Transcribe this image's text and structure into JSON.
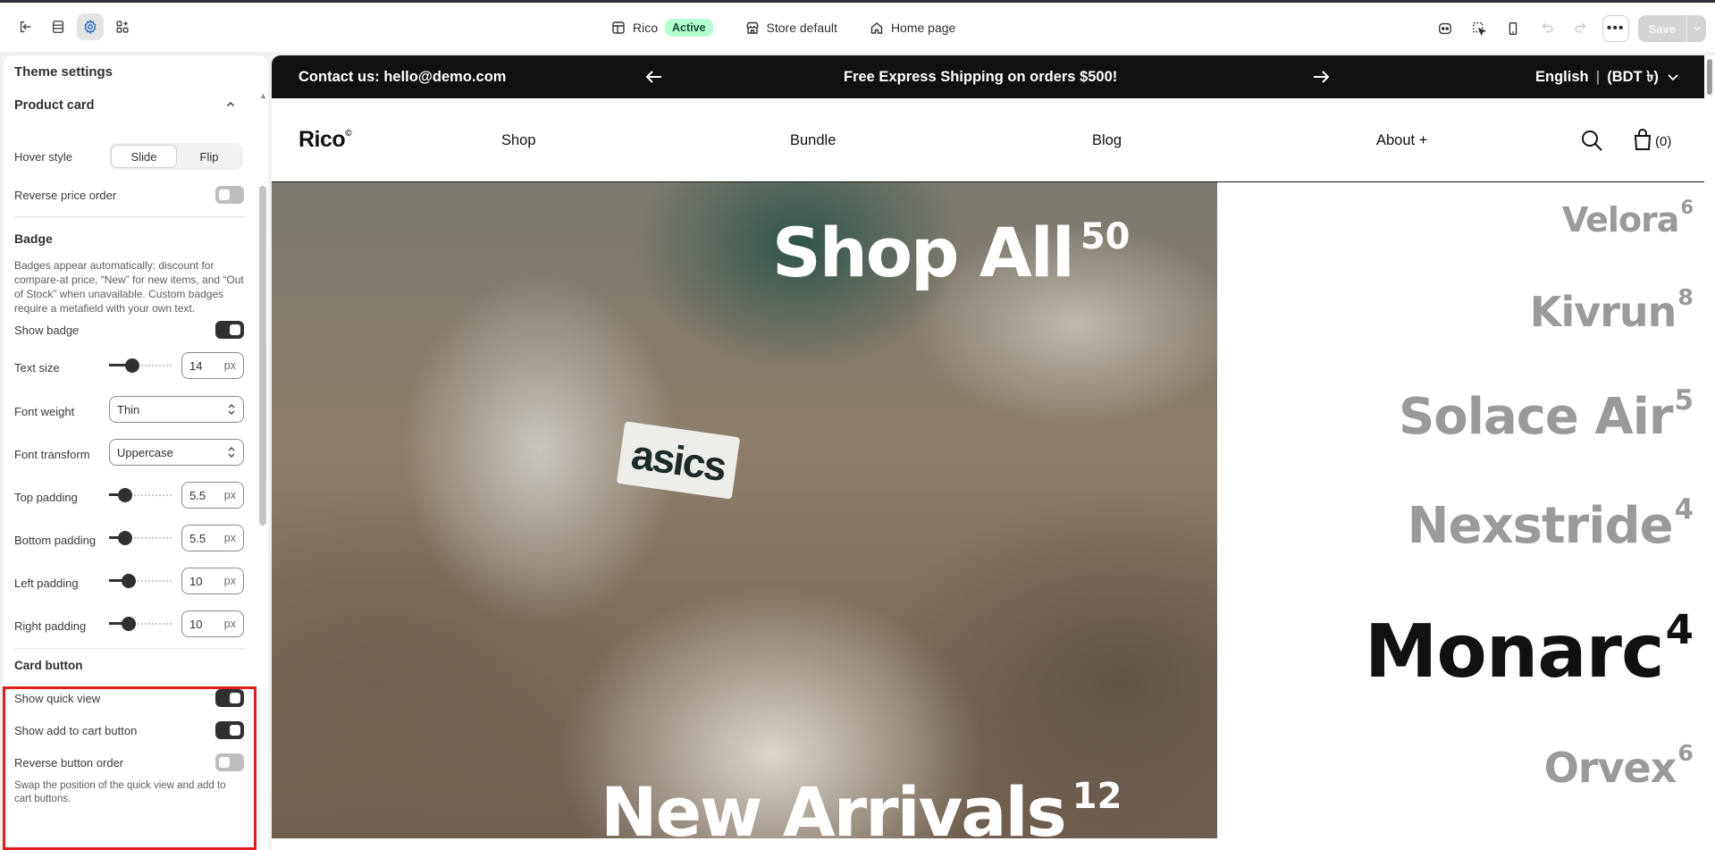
{
  "topbar": {
    "theme_name": "Rico",
    "theme_status": "Active",
    "store_scope": "Store default",
    "page_selector": "Home page",
    "save_label": "Save"
  },
  "sidebar": {
    "title": "Theme settings",
    "section_title": "Product card",
    "hover_style": {
      "label": "Hover style",
      "options": [
        "Slide",
        "Flip"
      ],
      "selected": "Slide"
    },
    "reverse_price_order": {
      "label": "Reverse price order",
      "on": false
    },
    "badge": {
      "heading": "Badge",
      "help": "Badges appear automatically: discount for compare-at price, “New” for new items, and “Out of Stock” when unavailable. Custom badges require a metafield with your own text.",
      "show_badge": {
        "label": "Show badge",
        "on": true
      },
      "text_size": {
        "label": "Text size",
        "value": "14",
        "unit": "px",
        "level": 0.33
      },
      "font_weight": {
        "label": "Font weight",
        "value": "Thin"
      },
      "font_transform": {
        "label": "Font transform",
        "value": "Uppercase"
      },
      "top_padding": {
        "label": "Top padding",
        "value": "5.5",
        "unit": "px",
        "level": 0.18
      },
      "bottom_padding": {
        "label": "Bottom padding",
        "value": "5.5",
        "unit": "px",
        "level": 0.18
      },
      "left_padding": {
        "label": "Left padding",
        "value": "10",
        "unit": "px",
        "level": 0.25
      },
      "right_padding": {
        "label": "Right padding",
        "value": "10",
        "unit": "px",
        "level": 0.25
      }
    },
    "card_button": {
      "heading": "Card button",
      "show_quick_view": {
        "label": "Show quick view",
        "on": true
      },
      "show_add_to_cart": {
        "label": "Show add to cart button",
        "on": true
      },
      "reverse_button_order": {
        "label": "Reverse button order",
        "on": false
      },
      "help": "Swap the position of the quick view and add to cart buttons."
    }
  },
  "preview": {
    "announcement": {
      "contact": "Contact us: hello@demo.com",
      "message": "Free Express Shipping on orders $500!",
      "language": "English",
      "currency": "(BDT ৳)"
    },
    "logo": "Rico",
    "logo_mark": "©",
    "nav": [
      "Shop",
      "Bundle",
      "Blog",
      "About +"
    ],
    "cart_count": "(0)",
    "hero_titles": [
      {
        "text": "Shop All",
        "count": "50"
      },
      {
        "text": "New Arrivals",
        "count": "12"
      }
    ],
    "categories": [
      {
        "name": "Velora",
        "count": "6"
      },
      {
        "name": "Kivrun",
        "count": "8"
      },
      {
        "name": "Solace Air",
        "count": "5"
      },
      {
        "name": "Nexstride",
        "count": "4"
      },
      {
        "name": "Monarc",
        "count": "4"
      },
      {
        "name": "Orvex",
        "count": "6"
      }
    ],
    "shoe_brand": "asics"
  }
}
